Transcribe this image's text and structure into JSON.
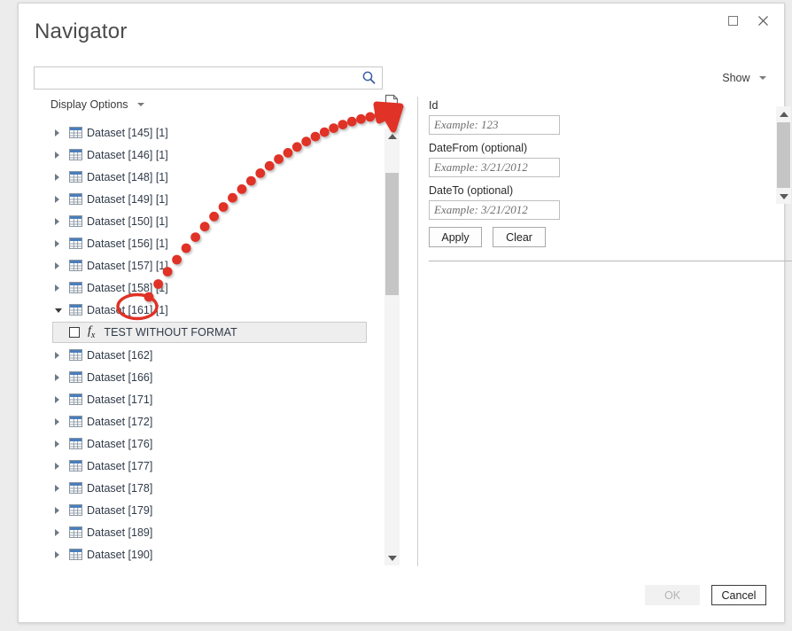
{
  "window": {
    "title": "Navigator",
    "controls": [
      {
        "name": "maximize",
        "glyph": "box"
      },
      {
        "name": "close",
        "glyph": "✕"
      }
    ]
  },
  "search": {
    "value": "",
    "placeholder": "",
    "icon": "search-icon"
  },
  "left_pane": {
    "display_options_label": "Display Options",
    "refresh_icon": "document-refresh-icon",
    "tree": [
      {
        "label": "Dataset [145] [1]",
        "expanded": false,
        "icon": "table-icon"
      },
      {
        "label": "Dataset [146] [1]",
        "expanded": false,
        "icon": "table-icon"
      },
      {
        "label": "Dataset [148] [1]",
        "expanded": false,
        "icon": "table-icon"
      },
      {
        "label": "Dataset [149] [1]",
        "expanded": false,
        "icon": "table-icon"
      },
      {
        "label": "Dataset [150] [1]",
        "expanded": false,
        "icon": "table-icon"
      },
      {
        "label": "Dataset [156] [1]",
        "expanded": false,
        "icon": "table-icon"
      },
      {
        "label": "Dataset [157] [1]",
        "expanded": false,
        "icon": "table-icon"
      },
      {
        "label": "Dataset [158] [1]",
        "expanded": false,
        "icon": "table-icon"
      },
      {
        "label": "Dataset [161] [1]",
        "expanded": true,
        "icon": "table-icon",
        "children": [
          {
            "label": "TEST WITHOUT FORMAT",
            "checked": false,
            "icon": "fx-icon",
            "selected": true
          }
        ]
      },
      {
        "label": "Dataset [162]",
        "expanded": false,
        "icon": "table-icon"
      },
      {
        "label": "Dataset [166]",
        "expanded": false,
        "icon": "table-icon"
      },
      {
        "label": "Dataset [171]",
        "expanded": false,
        "icon": "table-icon"
      },
      {
        "label": "Dataset [172]",
        "expanded": false,
        "icon": "table-icon"
      },
      {
        "label": "Dataset [176]",
        "expanded": false,
        "icon": "table-icon"
      },
      {
        "label": "Dataset [177]",
        "expanded": false,
        "icon": "table-icon"
      },
      {
        "label": "Dataset [178]",
        "expanded": false,
        "icon": "table-icon"
      },
      {
        "label": "Dataset [179]",
        "expanded": false,
        "icon": "table-icon"
      },
      {
        "label": "Dataset [189]",
        "expanded": false,
        "icon": "table-icon"
      },
      {
        "label": "Dataset [190]",
        "expanded": false,
        "icon": "table-icon"
      }
    ]
  },
  "right_pane": {
    "show_label": "Show",
    "fields": [
      {
        "label": "Id",
        "value": "",
        "placeholder": "Example: 123"
      },
      {
        "label": "DateFrom (optional)",
        "value": "",
        "placeholder": "Example: 3/21/2012"
      },
      {
        "label": "DateTo (optional)",
        "value": "",
        "placeholder": "Example: 3/21/2012"
      }
    ],
    "apply_label": "Apply",
    "clear_label": "Clear"
  },
  "footer": {
    "ok_label": "OK",
    "ok_enabled": false,
    "cancel_label": "Cancel"
  },
  "annotation": {
    "color": "#e03126",
    "highlight_target": "[161]",
    "shape": "dotted-curved-arrow"
  },
  "colors": {
    "dialog_bg": "#ffffff",
    "page_bg": "#ececed",
    "title_text": "#4b4b4b",
    "tree_text": "#2f3a48",
    "table_icon_header": "#4a7ebb",
    "annotation_red": "#e03126",
    "refresh_green": "#3f9c5a",
    "search_blue": "#3b5ea5"
  }
}
